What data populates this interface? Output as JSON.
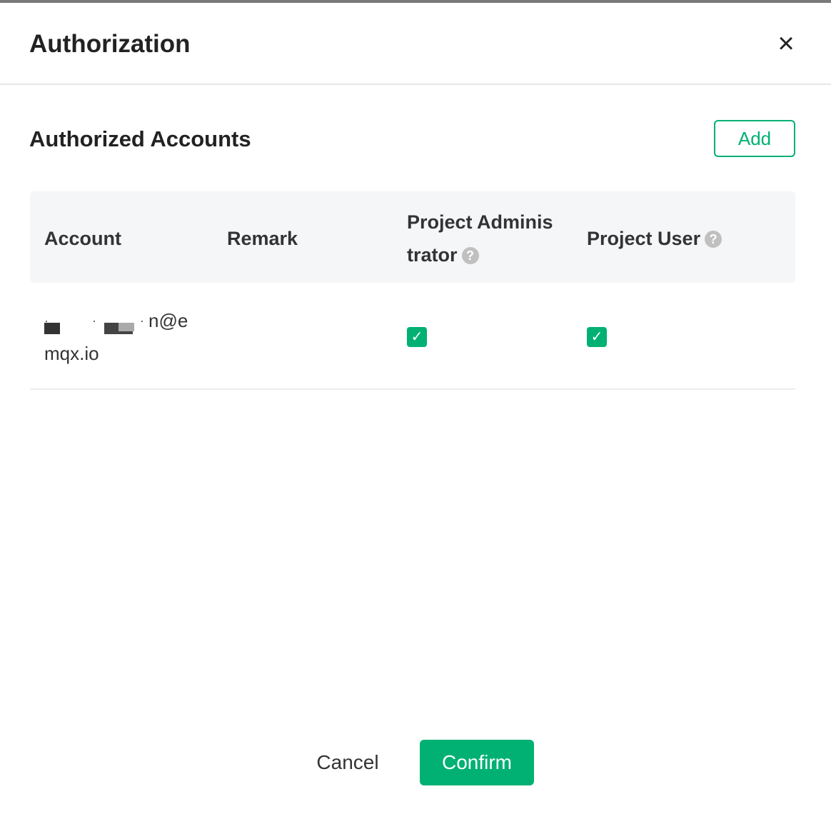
{
  "dialog": {
    "title": "Authorization",
    "close_icon": "close-icon"
  },
  "section": {
    "title": "Authorized Accounts",
    "add_label": "Add"
  },
  "table": {
    "columns": [
      "Account",
      "Remark",
      "Project Adminis\ntrator",
      "Project User"
    ],
    "rows": [
      {
        "account_line1": "n@e",
        "account_line2": "mqx.io",
        "remark": "",
        "project_administrator": true,
        "project_user": true
      }
    ]
  },
  "footer": {
    "cancel_label": "Cancel",
    "confirm_label": "Confirm"
  },
  "colors": {
    "accent": "#00b173",
    "header_bg": "#f5f6f8"
  }
}
